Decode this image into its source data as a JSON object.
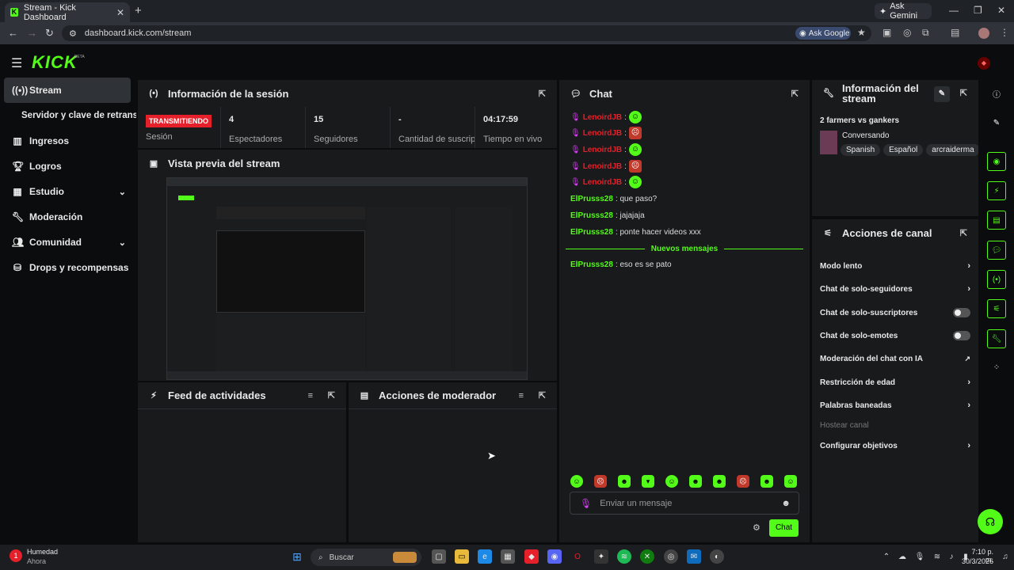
{
  "browser": {
    "tab_title": "Stream - Kick Dashboard",
    "address": "dashboard.kick.com/stream",
    "ask_gemini": "Ask Gemini",
    "ask_google": "Ask Google"
  },
  "header": {
    "logo": "KICK",
    "beta": "BETA"
  },
  "sidebar": {
    "items": [
      {
        "label": "Stream",
        "icon": "broadcast-icon"
      },
      {
        "label": "Servidor y clave de retransmisión",
        "icon": ""
      },
      {
        "label": "Ingresos",
        "icon": "chart-icon"
      },
      {
        "label": "Logros",
        "icon": "trophy-icon"
      },
      {
        "label": "Estudio",
        "icon": "studio-icon"
      },
      {
        "label": "Moderación",
        "icon": "wrench-icon"
      },
      {
        "label": "Comunidad",
        "icon": "community-icon"
      },
      {
        "label": "Drops y recompensas",
        "icon": "gift-icon"
      }
    ]
  },
  "session": {
    "title": "Información de la sesión",
    "status": "TRANSMITIENDO",
    "stats": [
      {
        "value": "",
        "label": "Sesión"
      },
      {
        "value": "4",
        "label": "Espectadores"
      },
      {
        "value": "15",
        "label": "Seguidores"
      },
      {
        "value": "-",
        "label": "Cantidad de suscripciones"
      },
      {
        "value": "04:17:59",
        "label": "Tiempo en vivo"
      }
    ]
  },
  "preview": {
    "title": "Vista previa del stream"
  },
  "activity": {
    "title": "Feed de actividades"
  },
  "modactions": {
    "title": "Acciones de moderador"
  },
  "chat": {
    "title": "Chat",
    "messages": [
      {
        "user": "LenoirdJB",
        "text": ":",
        "emote": "g",
        "mic": true
      },
      {
        "user": "LenoirdJB",
        "text": ":",
        "emote": "r",
        "mic": true
      },
      {
        "user": "LenoirdJB",
        "text": ":",
        "emote": "g",
        "mic": true
      },
      {
        "user": "LenoirdJB",
        "text": ":",
        "emote": "r",
        "mic": true
      },
      {
        "user": "LenoirdJB",
        "text": ":",
        "emote": "g",
        "mic": true
      },
      {
        "user": "ElPrusss28",
        "text": ": que paso?",
        "emote": "",
        "mic": false
      },
      {
        "user": "ElPrusss28",
        "text": ": jajajaja",
        "emote": "",
        "mic": false
      },
      {
        "user": "ElPrusss28",
        "text": ": ponte hacer videos xxx",
        "emote": "",
        "mic": false
      }
    ],
    "new_messages": "Nuevos mensajes",
    "after": {
      "user": "ElPrusss28",
      "text": ": eso es se pato"
    },
    "placeholder": "Enviar un mensaje",
    "send": "Chat"
  },
  "stream_info": {
    "title": "Información del stream",
    "stream_title": "2 farmers vs gankers",
    "category": "Conversando",
    "tags": [
      "Spanish",
      "Español",
      "arcraiderma"
    ]
  },
  "channel_actions": {
    "title": "Acciones de canal",
    "items": [
      {
        "label": "Modo lento",
        "control": "chevron"
      },
      {
        "label": "Chat de solo-seguidores",
        "control": "chevron"
      },
      {
        "label": "Chat de solo-suscriptores",
        "control": "toggle"
      },
      {
        "label": "Chat de solo-emotes",
        "control": "toggle"
      },
      {
        "label": "Moderación del chat con IA",
        "control": "external"
      },
      {
        "label": "Restricción de edad",
        "control": "chevron"
      },
      {
        "label": "Palabras baneadas",
        "control": "chevron"
      },
      {
        "label": "Hostear canal",
        "control": "disabled"
      },
      {
        "label": "Configurar objetivos",
        "control": "chevron"
      }
    ]
  },
  "taskbar": {
    "weather_label": "Humedad",
    "weather_sub": "Ahora",
    "weather_badge": "1",
    "search": "Buscar",
    "time": "7:10 p. m.",
    "date": "30/3/2026"
  },
  "colors": {
    "accent": "#53fc18",
    "live": "#e5202a",
    "panel": "#181a1c"
  }
}
